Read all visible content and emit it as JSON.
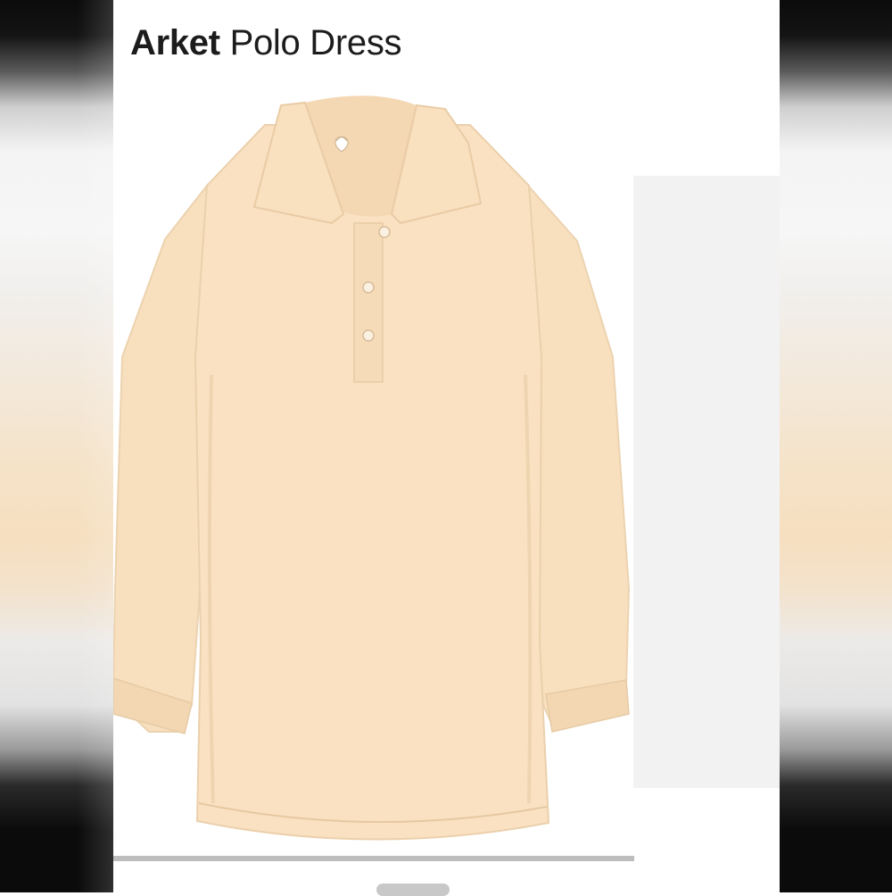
{
  "listing": {
    "brand": "Arket",
    "product": "Polo Dress"
  },
  "colors": {
    "dress": "#f8dfbe",
    "dress_shadow": "#ecd0ab",
    "panel": "#f2f2f2"
  },
  "icons": {
    "image_scrollbar": "scroll-track",
    "carousel_indicator": "pill-indicator"
  }
}
